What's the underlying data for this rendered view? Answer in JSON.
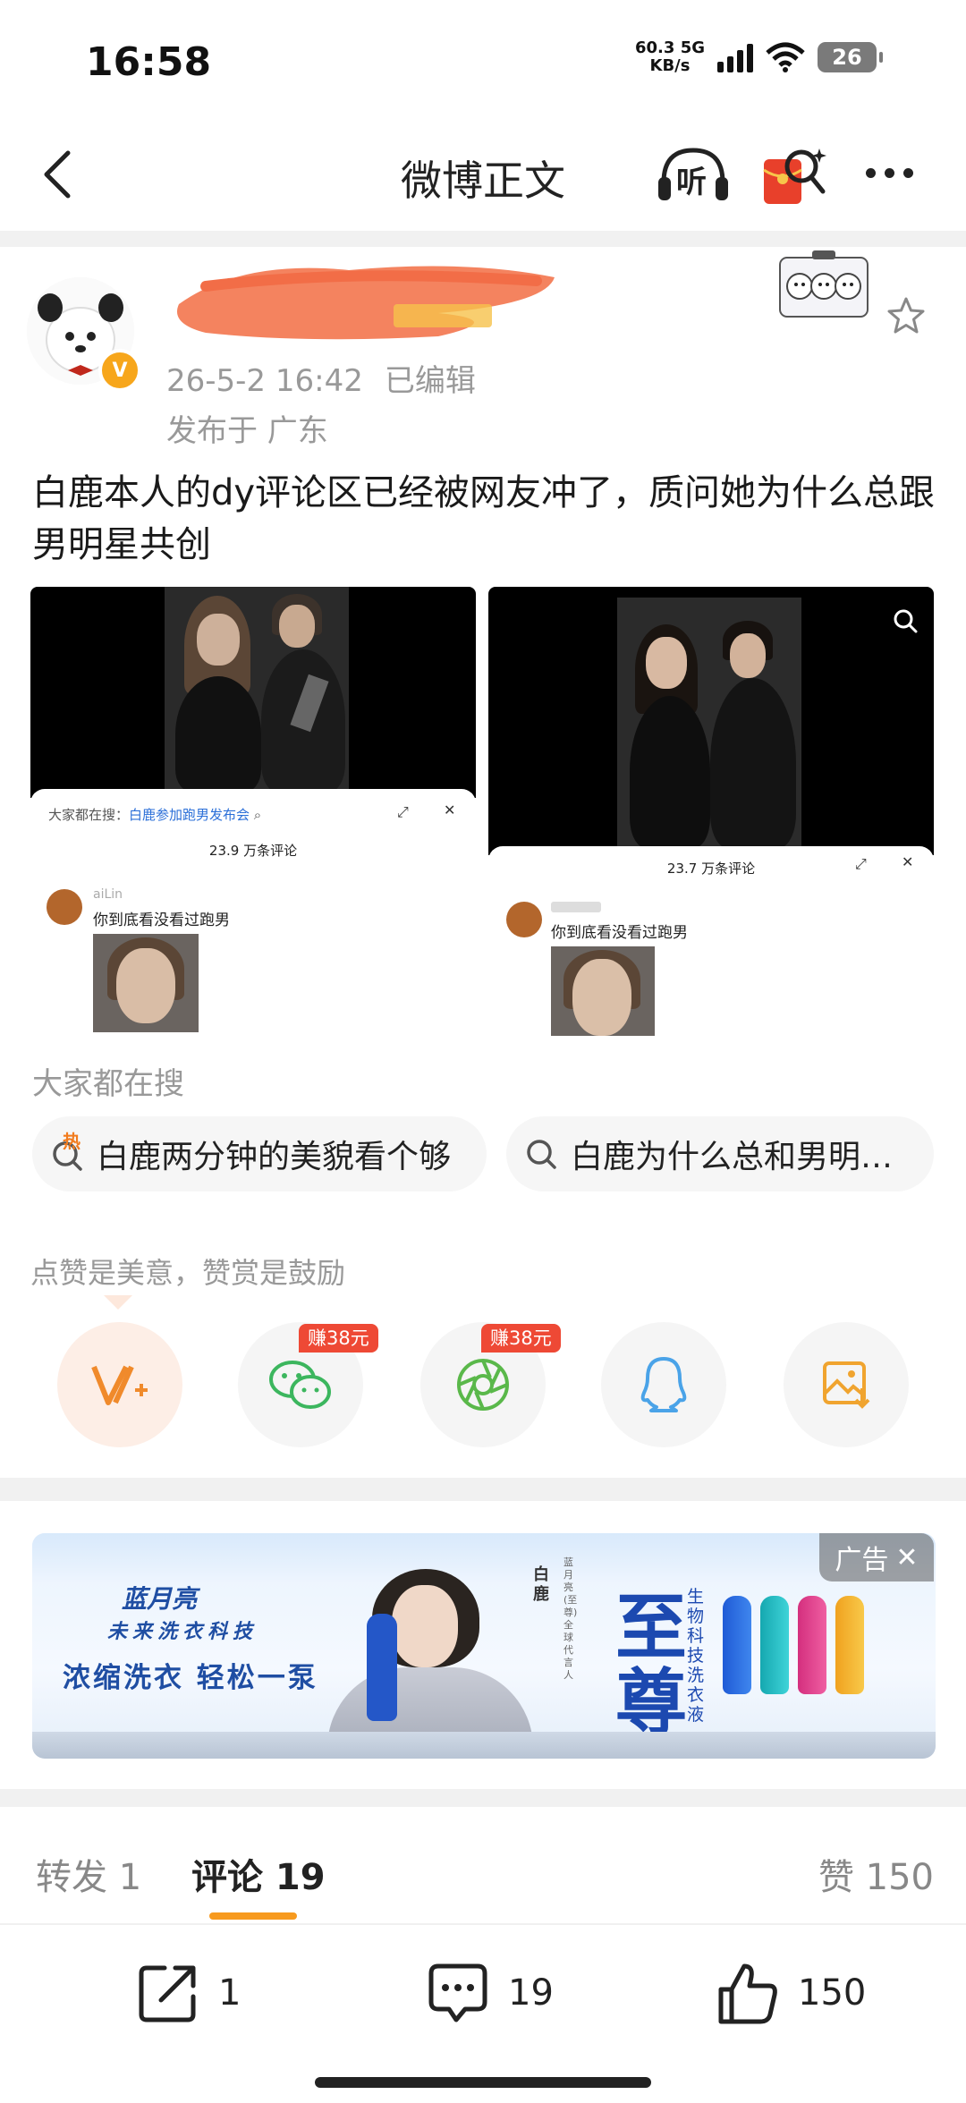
{
  "status_bar": {
    "time": "16:58",
    "speed_value": "60.3",
    "speed_unit": "KB/s",
    "network": "5G",
    "battery": "26"
  },
  "nav": {
    "title": "微博正文",
    "listen_label": "听"
  },
  "post": {
    "meta_time": "26-5-2 16:42",
    "edited": "已编辑",
    "location": "发布于 广东",
    "text": "白鹿本人的dy评论区已经被网友冲了，质问她为什么总跟男明星共创",
    "images": [
      {
        "search_prefix": "大家都在搜：",
        "search_link": "白鹿参加跑男发布会",
        "comment_count": "23.9 万条评论",
        "commenter": "aiLin",
        "comment": "你到底看没看过跑男"
      },
      {
        "comment_count": "23.7 万条评论",
        "comment": "你到底看没看过跑男"
      }
    ]
  },
  "search_section": {
    "title": "大家都在搜",
    "hot_badge": "热",
    "chips": [
      "白鹿两分钟的美貌看个够",
      "白鹿为什么总和男明…"
    ]
  },
  "reward": {
    "label": "点赞是美意，赞赏是鼓励",
    "earn_badge": "赚38元"
  },
  "ad": {
    "tag": "广告",
    "brand": "蓝月亮",
    "slogan1": "未来洗衣科技",
    "slogan2": "浓缩洗衣 轻松一泵",
    "product": "至尊",
    "product_sub": "生物科技洗衣液",
    "endorser": "白鹿",
    "endorser_note": "蓝月亮(至尊)全球代言人"
  },
  "tabs": {
    "repost": "转发 1",
    "comment": "评论 19",
    "like": "赞 150"
  },
  "actions": {
    "repost": "1",
    "comment": "19",
    "like": "150"
  },
  "colors": {
    "accent": "#f79a1e",
    "redact": "#f4835f",
    "earn_badge": "#ee4935",
    "ad_blue": "#1c49b0"
  }
}
